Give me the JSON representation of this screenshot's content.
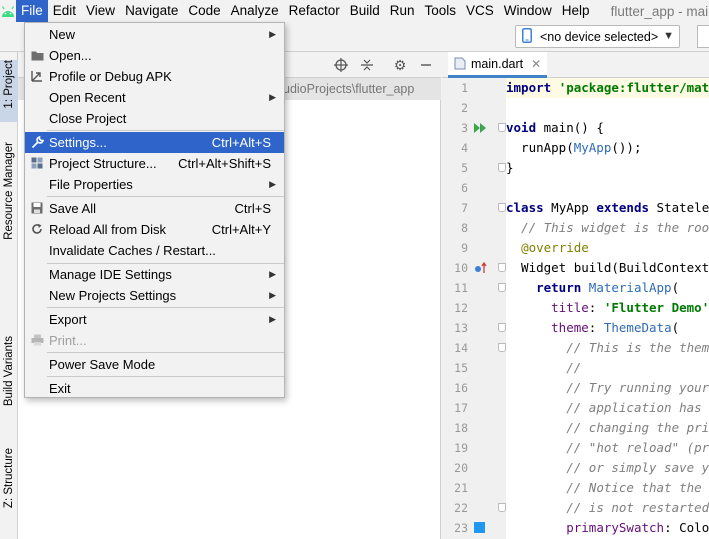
{
  "menubar": {
    "items": [
      "File",
      "Edit",
      "View",
      "Navigate",
      "Code",
      "Analyze",
      "Refactor",
      "Build",
      "Run",
      "Tools",
      "VCS",
      "Window",
      "Help"
    ],
    "window_title": "flutter_app - main.dart"
  },
  "toolbar": {
    "device_selector": "<no device selected>"
  },
  "left_tabs": [
    "1: Project",
    "Resource Manager",
    "Build Variants",
    "Z: Structure"
  ],
  "project_panel": {
    "path_fragment": "udioProjects\\flutter_app"
  },
  "editor": {
    "tab_label": "main.dart",
    "line_numbers": [
      "1",
      "2",
      "3",
      "4",
      "5",
      "6",
      "7",
      "8",
      "9",
      "10",
      "11",
      "12",
      "13",
      "14",
      "15",
      "16",
      "17",
      "18",
      "19",
      "20",
      "21",
      "22",
      "23"
    ]
  },
  "file_menu": {
    "items": [
      {
        "label": "New",
        "shortcut": "",
        "submenu": true,
        "icon": "none"
      },
      {
        "label": "Open...",
        "shortcut": "",
        "submenu": false,
        "icon": "folder-icon"
      },
      {
        "label": "Profile or Debug APK",
        "shortcut": "",
        "submenu": false,
        "icon": "apk-icon"
      },
      {
        "label": "Open Recent",
        "shortcut": "",
        "submenu": true,
        "icon": "none"
      },
      {
        "label": "Close Project",
        "shortcut": "",
        "submenu": false,
        "icon": "none"
      },
      {
        "label": "Settings...",
        "shortcut": "Ctrl+Alt+S",
        "submenu": false,
        "icon": "wrench-icon"
      },
      {
        "label": "Project Structure...",
        "shortcut": "Ctrl+Alt+Shift+S",
        "submenu": false,
        "icon": "project-structure-icon"
      },
      {
        "label": "File Properties",
        "shortcut": "",
        "submenu": true,
        "icon": "none"
      },
      {
        "label": "Save All",
        "shortcut": "Ctrl+S",
        "submenu": false,
        "icon": "save-icon"
      },
      {
        "label": "Reload All from Disk",
        "shortcut": "Ctrl+Alt+Y",
        "submenu": false,
        "icon": "reload-icon"
      },
      {
        "label": "Invalidate Caches / Restart...",
        "shortcut": "",
        "submenu": false,
        "icon": "none"
      },
      {
        "label": "Manage IDE Settings",
        "shortcut": "",
        "submenu": true,
        "icon": "none"
      },
      {
        "label": "New Projects Settings",
        "shortcut": "",
        "submenu": true,
        "icon": "none"
      },
      {
        "label": "Export",
        "shortcut": "",
        "submenu": true,
        "icon": "none"
      },
      {
        "label": "Print...",
        "shortcut": "",
        "submenu": false,
        "icon": "print-icon"
      },
      {
        "label": "Power Save Mode",
        "shortcut": "",
        "submenu": false,
        "icon": "none"
      },
      {
        "label": "Exit",
        "shortcut": "",
        "submenu": false,
        "icon": "none"
      }
    ],
    "highlighted": "Settings...",
    "disabled": [
      "Print..."
    ]
  },
  "colors": {
    "menu_highlight": "#2f65ca",
    "editor_tab_underline": "#4083c9"
  }
}
